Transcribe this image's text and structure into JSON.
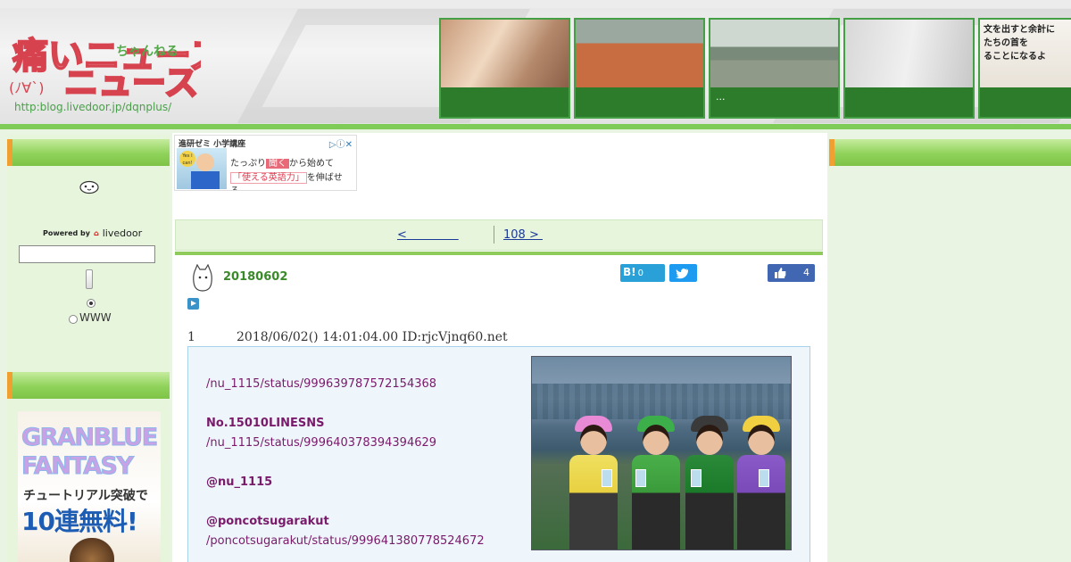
{
  "header": {
    "logo_main": "痛いニュース",
    "logo_sub": "ちゃんねる",
    "logo_face": "(ﾉ∀`)",
    "logo_url": "http:blog.livedoor.jp/dqnplus/",
    "thumbnails": [
      {
        "caption": ""
      },
      {
        "caption": ""
      },
      {
        "caption": "..."
      },
      {
        "caption": ""
      },
      {
        "caption": "",
        "overlay_text": [
          "文を出すと余計に",
          "たちの首を",
          "ることになるよ"
        ]
      }
    ]
  },
  "sidebar": {
    "powered_by": "Powered by",
    "brand": "livedoor",
    "search_value": "",
    "radio_www": "WWW",
    "banner": {
      "line1": "GRANBLUE",
      "line2": "FANTASY",
      "line3": "チュートリアル突破で",
      "line4": "10連無料!"
    }
  },
  "ad": {
    "header": "進研ゼミ 小学講座",
    "line1_pre": "たっぷり",
    "line1_highlight": "聞く",
    "line1_post": "から始めて",
    "line2_highlight": "「使える英語力」",
    "line2_post": "を伸ばせる。",
    "badge": "Yes I can!"
  },
  "pager": {
    "prev": "<              ",
    "next": "108 > "
  },
  "post": {
    "title": "20180602",
    "hatena_label": "B!",
    "hatena_count": "0",
    "like_count": "4"
  },
  "response": {
    "number": "1",
    "meta": "2018/06/02() 14:01:04.00 ID:rjcVjnq60.net",
    "lines": [
      {
        "text": "/nu_1115/status/999639787572154368",
        "bold": false
      },
      {
        "text": "No.15010LINESNS",
        "bold": true
      },
      {
        "text": "/nu_1115/status/999640378394394629",
        "bold": false
      },
      {
        "text": "@nu_1115",
        "bold": true
      },
      {
        "text": "@poncotsugarakut",
        "bold": true
      },
      {
        "text": "/poncotsugarakut/status/999641380778524672",
        "bold": false
      }
    ]
  },
  "colors": {
    "green_accent": "#8ecb5a",
    "link": "#1a3a9a",
    "res_text": "#7a1a6a",
    "title_green": "#3a8a2a"
  }
}
